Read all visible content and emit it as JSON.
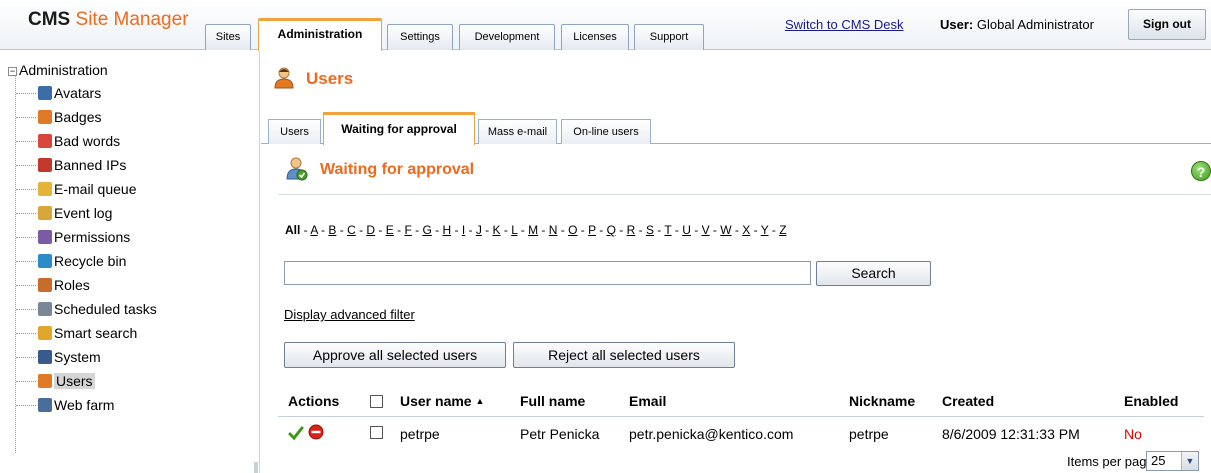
{
  "header": {
    "logo_main": "CMS",
    "logo_sub": "Site Manager",
    "tabs": [
      {
        "label": "Sites"
      },
      {
        "label": "Administration"
      },
      {
        "label": "Settings"
      },
      {
        "label": "Development"
      },
      {
        "label": "Licenses"
      },
      {
        "label": "Support"
      }
    ],
    "switch_link": "Switch to CMS Desk",
    "user_prefix": "User:",
    "user_name": "Global Administrator",
    "signout_label": "Sign out"
  },
  "tree": {
    "root_toggle": "−",
    "root_label": "Administration",
    "items": [
      {
        "label": "Avatars",
        "icon": "avatars-icon",
        "color": "#3b6ea8"
      },
      {
        "label": "Badges",
        "icon": "badges-icon",
        "color": "#e07a25"
      },
      {
        "label": "Bad words",
        "icon": "bad-words-icon",
        "color": "#d9473c"
      },
      {
        "label": "Banned IPs",
        "icon": "banned-ips-icon",
        "color": "#c0392b"
      },
      {
        "label": "E-mail queue",
        "icon": "email-queue-icon",
        "color": "#e2b53a"
      },
      {
        "label": "Event log",
        "icon": "event-log-icon",
        "color": "#d9a63a"
      },
      {
        "label": "Permissions",
        "icon": "permissions-icon",
        "color": "#7b5aa6"
      },
      {
        "label": "Recycle bin",
        "icon": "recycle-bin-icon",
        "color": "#2e8bc9"
      },
      {
        "label": "Roles",
        "icon": "roles-icon",
        "color": "#c96b2a"
      },
      {
        "label": "Scheduled tasks",
        "icon": "scheduled-tasks-icon",
        "color": "#7a8796"
      },
      {
        "label": "Smart search",
        "icon": "smart-search-icon",
        "color": "#e0a72b"
      },
      {
        "label": "System",
        "icon": "system-icon",
        "color": "#365b8c"
      },
      {
        "label": "Users",
        "icon": "users-icon",
        "color": "#e07a25"
      },
      {
        "label": "Web farm",
        "icon": "web-farm-icon",
        "color": "#4a6d9a"
      }
    ]
  },
  "page": {
    "title": "Users",
    "tabs": [
      {
        "label": "Users"
      },
      {
        "label": "Waiting for approval"
      },
      {
        "label": "Mass e-mail"
      },
      {
        "label": "On-line users"
      }
    ],
    "section_title": "Waiting for approval",
    "help_glyph": "?"
  },
  "filter": {
    "alphabet_all": "All",
    "letters": [
      "A",
      "B",
      "C",
      "D",
      "E",
      "F",
      "G",
      "H",
      "I",
      "J",
      "K",
      "L",
      "M",
      "N",
      "O",
      "P",
      "Q",
      "R",
      "S",
      "T",
      "U",
      "V",
      "W",
      "X",
      "Y",
      "Z"
    ],
    "search_value": "",
    "search_button": "Search",
    "advanced_filter": "Display advanced filter"
  },
  "actions": {
    "approve_all": "Approve all selected users",
    "reject_all": "Reject all selected users"
  },
  "grid": {
    "columns": [
      "Actions",
      "",
      "User name",
      "Full name",
      "Email",
      "Nickname",
      "Created",
      "Enabled"
    ],
    "sort_glyph": "▲",
    "rows": [
      {
        "user_name": "petrpe",
        "full_name": "Petr Penicka",
        "email": "petr.penicka@kentico.com",
        "nickname": "petrpe",
        "created": "8/6/2009 12:31:33 PM",
        "enabled": "No"
      }
    ]
  },
  "pager": {
    "label": "Items per page:",
    "value": "25"
  },
  "colors": {
    "accent_orange": "#ee6a1d",
    "enabled_no": "#e00000",
    "approve_green": "#3a9a16",
    "reject_red": "#d9231a"
  }
}
